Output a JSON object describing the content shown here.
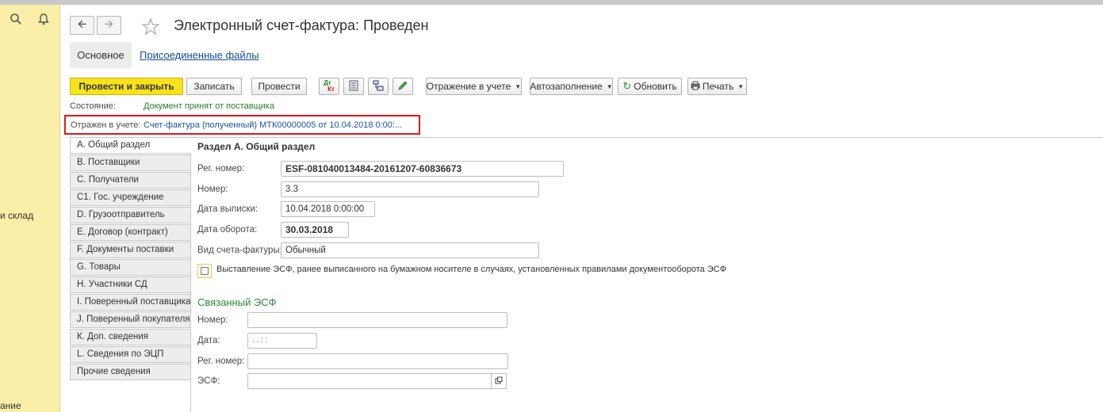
{
  "left_panel": {
    "text_1": "и склад",
    "text_2": "ание"
  },
  "header": {
    "title": "Электронный счет-фактура: Проведен"
  },
  "tabs": {
    "main": "Основное",
    "files": "Присоединенные файлы"
  },
  "toolbar": {
    "post_close": "Провести и закрыть",
    "save": "Записать",
    "post": "Провести",
    "accounting": "Отражение в учете",
    "autofill": "Автозаполнение",
    "refresh": "Обновить",
    "print": "Печать",
    "dt_kt_top": "Дт",
    "dt_kt_bottom": "Кт"
  },
  "status": {
    "label": "Состояние:",
    "value": "Документ принят от поставщика"
  },
  "reflection": {
    "label": "Отражен в учете:",
    "link": "Счет-фактура (полученный) МТК00000005 от 10.04.2018 0:00:..."
  },
  "sections": [
    "А. Общий раздел",
    "В. Поставщики",
    "С. Получатели",
    "С1. Гос. учреждение",
    "D. Грузоотправитель",
    "Е. Договор (контракт)",
    "F. Документы поставки",
    "G. Товары",
    "Н. Участники СД",
    "I. Поверенный поставщика",
    "J. Поверенный покупателя",
    "К. Доп. сведения",
    "L. Сведения по ЭЦП",
    "Прочие сведения"
  ],
  "form": {
    "title": "Раздел А. Общий раздел",
    "reg_label": "Рег. номер:",
    "reg_value": "ESF-081040013484-20161207-60836673",
    "num_label": "Номер:",
    "num_value": "3.3",
    "date_issue_label": "Дата выписки:",
    "date_issue_value": "10.04.2018  0:00:00",
    "date_turnover_label": "Дата оборота:",
    "date_turnover_value": "30.03.2018",
    "type_label": "Вид счета-фактуры:",
    "type_value": "Обычный",
    "checkbox_label": "Выставление ЭСФ, ранее выписанного на бумажном носителе в случаях, установленных правилами документооборота ЭСФ",
    "checkbox_checked": false
  },
  "linked": {
    "title": "Связанный ЭСФ",
    "num_label": "Номер:",
    "num_value": "",
    "date_label": "Дата:",
    "date_value": "  .  .      :  :",
    "reg_label": "Рег. номер:",
    "reg_value": "",
    "esf_label": "ЭСФ:",
    "esf_value": ""
  }
}
